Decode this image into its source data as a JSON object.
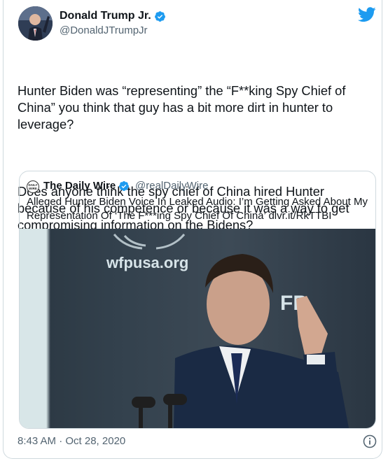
{
  "tweet": {
    "author_name": "Donald Trump Jr.",
    "handle": "@DonaldJTrumpJr",
    "paragraphs": [
      "Hunter Biden was “representing” the “F**king Spy Chief of China” you think that guy has a bit more dirt in hunter to leverage?",
      "Does anyone think the spy chief of China hired Hunter because of his competence or because it was a way to get compromising information on the Bidens?"
    ],
    "timestamp": "8:43 AM · Oct 28, 2020"
  },
  "quote": {
    "logo_text": "DAILY WIRE",
    "author_name": "The Daily Wire",
    "handle": "@realDailyWire",
    "text": "Alleged Hunter Biden Voice In Leaked Audio: I’m Getting Asked About My Representation Of ‘The F***ing Spy Chief Of China’ dlvr.it/RkTTBI",
    "image_sign_text": "wfpusa.org",
    "image_sign_text2": "FP"
  },
  "colors": {
    "twitter_blue": "#1d9bf0",
    "text_primary": "#0f1419",
    "text_secondary": "#536471",
    "border": "#cfd9de"
  },
  "icons": {
    "verified": "verified-badge-icon",
    "twitter": "twitter-bird-icon",
    "info": "info-circle-icon"
  }
}
